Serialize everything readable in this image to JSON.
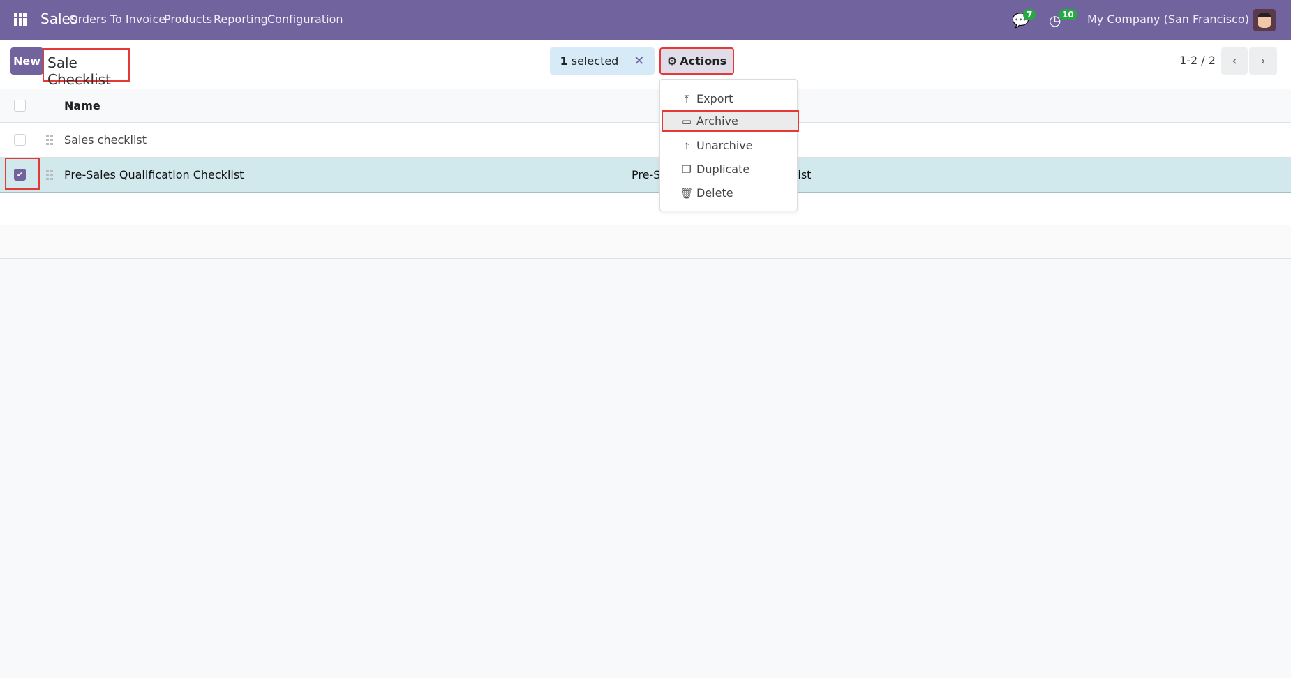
{
  "navbar": {
    "app": "Sales",
    "menu": [
      "Orders",
      "To Invoice",
      "Products",
      "Reporting",
      "Configuration"
    ],
    "messages_count": "7",
    "activities_count": "10",
    "company": "My Company (San Francisco)"
  },
  "control": {
    "new_label": "New",
    "title": "Sale Checklist",
    "selected_count": "1",
    "selected_label": "selected",
    "actions_label": "Actions",
    "pager": "1-2 / 2"
  },
  "actions_menu": [
    {
      "label": "Export",
      "icon": "upload-icon"
    },
    {
      "label": "Archive",
      "icon": "inbox-icon"
    },
    {
      "label": "Unarchive",
      "icon": "unarchive-icon"
    },
    {
      "label": "Duplicate",
      "icon": "copy-icon"
    },
    {
      "label": "Delete",
      "icon": "trash-icon"
    }
  ],
  "table": {
    "columns": [
      "Name"
    ],
    "rows": [
      {
        "name": "Sales checklist",
        "selected": false
      },
      {
        "name": "Pre-Sales Qualification Checklist",
        "selected": true
      }
    ]
  },
  "colors": {
    "brand": "#71639e",
    "selected_row": "#d1e8ed",
    "badge": "#28a745",
    "highlight": "#e53935"
  }
}
